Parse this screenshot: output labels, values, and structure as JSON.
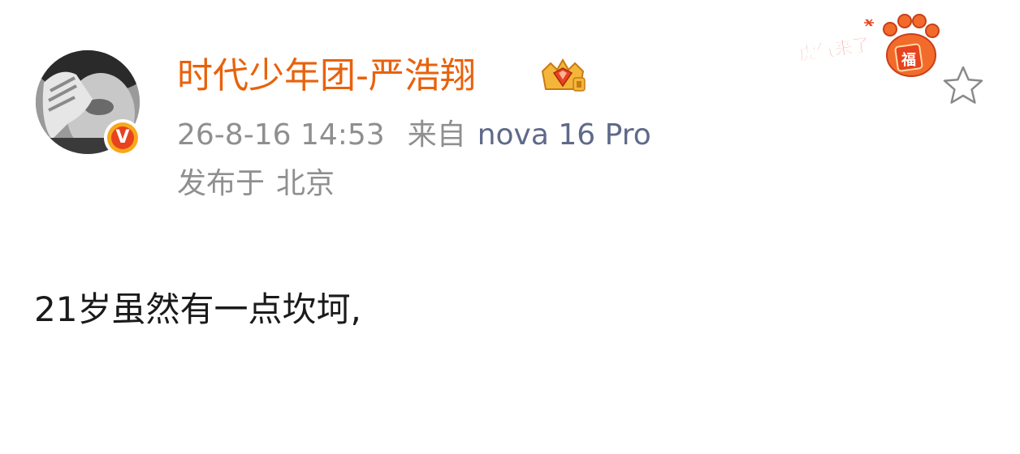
{
  "post": {
    "author": {
      "name": "时代少年团-严浩翔",
      "verified_badge_glyph": "V",
      "vip_badge_icon": "crown-diamond-icon",
      "name_color": "#e8620c"
    },
    "timestamp": "26-8-16 14:53",
    "source_label": "来自",
    "device": "nova 16 Pro",
    "location_label": "发布于",
    "location": "北京",
    "content": "21岁虽然有一点坎坷,",
    "sticker": {
      "icon": "tiger-paw-sticker-icon",
      "text": "虎气来了",
      "badge_text": "福"
    },
    "favorite_icon": "star-outline-icon"
  },
  "colors": {
    "meta_gray": "#8f8f8f",
    "device_blue_gray": "#5f6a8a",
    "body_text": "#1a1a1a",
    "verified_orange": "#f7a81b",
    "sticker_red": "#e8421e"
  }
}
